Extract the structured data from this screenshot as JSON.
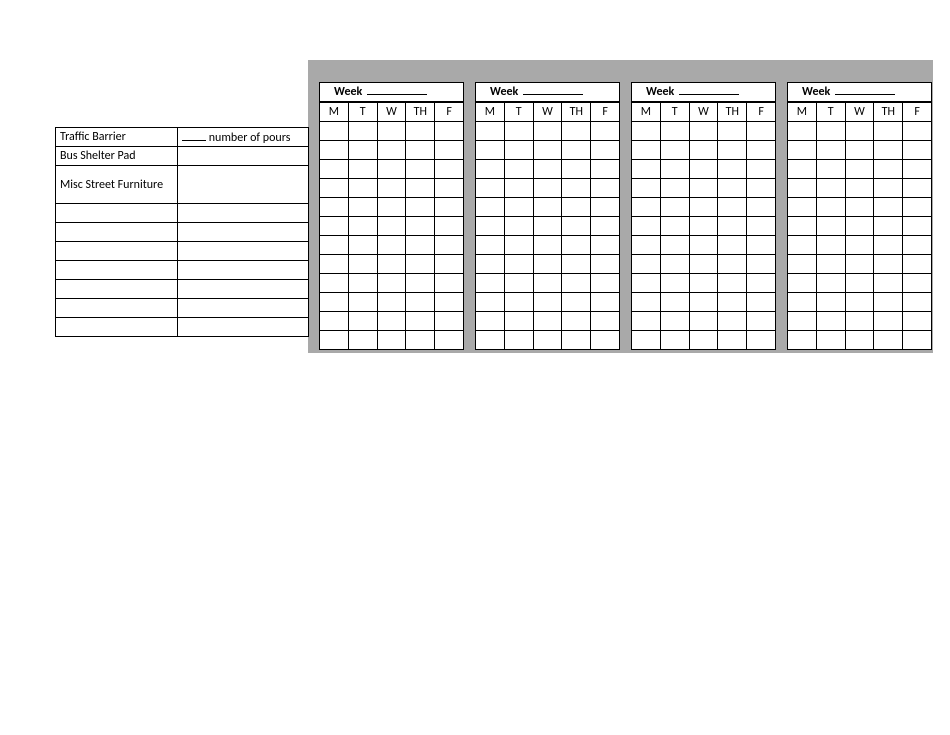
{
  "week_label": "Week",
  "days": [
    "M",
    "T",
    "W",
    "TH",
    "F"
  ],
  "rows": [
    {
      "label": "Traffic Barrier",
      "note_suffix": "number of pours",
      "note_has_blank": true
    },
    {
      "label": "Bus Shelter Pad",
      "note_suffix": ""
    },
    {
      "label": "Misc Street Furniture",
      "note_suffix": "",
      "tall": true
    },
    {
      "label": "",
      "note_suffix": ""
    },
    {
      "label": "",
      "note_suffix": ""
    },
    {
      "label": "",
      "note_suffix": ""
    },
    {
      "label": "",
      "note_suffix": ""
    },
    {
      "label": "",
      "note_suffix": ""
    },
    {
      "label": "",
      "note_suffix": ""
    },
    {
      "label": "",
      "note_suffix": ""
    }
  ],
  "week_count": 4,
  "grid_row_count": 12
}
